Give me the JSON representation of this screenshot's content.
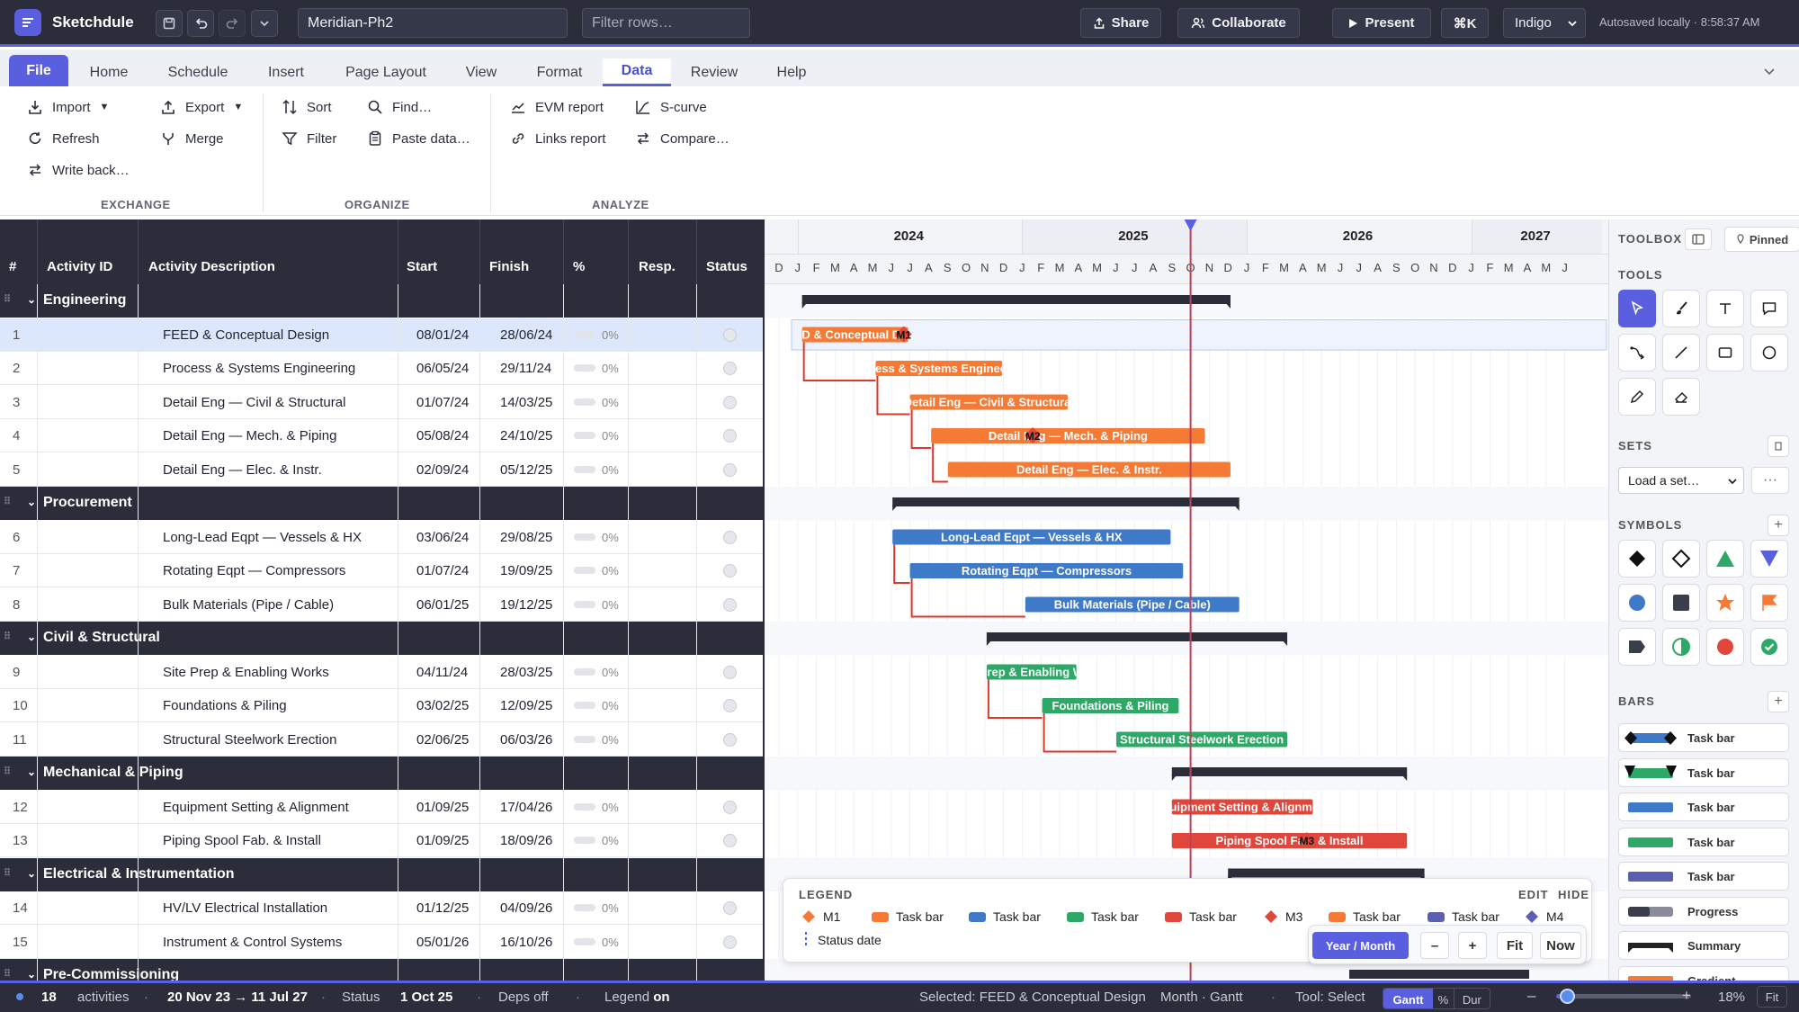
{
  "app": {
    "name": "Sketchdule",
    "doc_name": "Meridian-Ph2",
    "filter_placeholder": "Filter rows…",
    "autosave": "Autosaved locally · 8:58:37 AM"
  },
  "topbar": {
    "share": "Share",
    "collaborate": "Collaborate",
    "present": "Present",
    "shortcut": "⌘K",
    "theme": "Indigo"
  },
  "tabs": [
    "File",
    "Home",
    "Schedule",
    "Insert",
    "Page Layout",
    "View",
    "Format",
    "Data",
    "Review",
    "Help"
  ],
  "active_tab": "Data",
  "ribbon": {
    "exchange": {
      "label": "EXCHANGE",
      "items": [
        "Import",
        "Export",
        "Refresh",
        "Merge",
        "Write back…"
      ]
    },
    "organize": {
      "label": "ORGANIZE",
      "items": [
        "Sort",
        "Find…",
        "Filter",
        "Paste data…"
      ]
    },
    "analyze": {
      "label": "ANALYZE",
      "items": [
        "EVM report",
        "S-curve",
        "Links report",
        "Compare…"
      ]
    }
  },
  "columns": [
    "#",
    "Activity ID",
    "Activity Description",
    "Start",
    "Finish",
    "%",
    "Resp.",
    "Status"
  ],
  "groups": [
    {
      "name": "Engineering",
      "color": "#f47a35",
      "rows": [
        {
          "n": "1",
          "desc": "FEED & Conceptual Design",
          "start": "08/01/24",
          "finish": "28/06/24",
          "pct": "0%",
          "milestone": "M1"
        },
        {
          "n": "2",
          "desc": "Process & Systems Engineering",
          "start": "06/05/24",
          "finish": "29/11/24",
          "pct": "0%"
        },
        {
          "n": "3",
          "desc": "Detail Eng — Civil & Structural",
          "start": "01/07/24",
          "finish": "14/03/25",
          "pct": "0%"
        },
        {
          "n": "4",
          "desc": "Detail Eng — Mech. & Piping",
          "start": "05/08/24",
          "finish": "24/10/25",
          "pct": "0%",
          "milestone": "M2"
        },
        {
          "n": "5",
          "desc": "Detail Eng — Elec. & Instr.",
          "start": "02/09/24",
          "finish": "05/12/25",
          "pct": "0%"
        }
      ]
    },
    {
      "name": "Procurement",
      "color": "#3f7ac8",
      "rows": [
        {
          "n": "6",
          "desc": "Long-Lead Eqpt — Vessels & HX",
          "start": "03/06/24",
          "finish": "29/08/25",
          "pct": "0%"
        },
        {
          "n": "7",
          "desc": "Rotating Eqpt — Compressors",
          "start": "01/07/24",
          "finish": "19/09/25",
          "pct": "0%"
        },
        {
          "n": "8",
          "desc": "Bulk Materials (Pipe / Cable)",
          "start": "06/01/25",
          "finish": "19/12/25",
          "pct": "0%"
        }
      ]
    },
    {
      "name": "Civil & Structural",
      "color": "#2ea866",
      "rows": [
        {
          "n": "9",
          "desc": "Site Prep & Enabling Works",
          "start": "04/11/24",
          "finish": "28/03/25",
          "pct": "0%"
        },
        {
          "n": "10",
          "desc": "Foundations & Piling",
          "start": "03/02/25",
          "finish": "12/09/25",
          "pct": "0%"
        },
        {
          "n": "11",
          "desc": "Structural Steelwork Erection",
          "start": "02/06/25",
          "finish": "06/03/26",
          "pct": "0%"
        }
      ]
    },
    {
      "name": "Mechanical & Piping",
      "color": "#e0463a",
      "rows": [
        {
          "n": "12",
          "desc": "Equipment Setting & Alignment",
          "start": "01/09/25",
          "finish": "17/04/26",
          "pct": "0%"
        },
        {
          "n": "13",
          "desc": "Piping Spool Fab. & Install",
          "start": "01/09/25",
          "finish": "18/09/26",
          "pct": "0%",
          "milestone": "M3"
        }
      ]
    },
    {
      "name": "Electrical & Instrumentation",
      "color": "#f47a35",
      "rows": [
        {
          "n": "14",
          "desc": "HV/LV Electrical Installation",
          "start": "01/12/25",
          "finish": "04/09/26",
          "pct": "0%"
        },
        {
          "n": "15",
          "desc": "Instrument & Control Systems",
          "start": "05/01/26",
          "finish": "16/10/26",
          "pct": "0%"
        }
      ]
    },
    {
      "name": "Pre-Commissioning",
      "color": "#f47a35",
      "rows": []
    }
  ],
  "gantt": {
    "years": [
      "2024",
      "2025",
      "2026",
      "2027"
    ],
    "months": [
      "D",
      "J",
      "F",
      "M",
      "A",
      "M",
      "J",
      "J",
      "A",
      "S",
      "O",
      "N",
      "D",
      "J",
      "F",
      "M",
      "A",
      "M",
      "J",
      "J",
      "A",
      "S",
      "O",
      "N",
      "D",
      "J",
      "F",
      "M",
      "A",
      "M",
      "J",
      "J",
      "A",
      "S",
      "O",
      "N",
      "D",
      "J",
      "F",
      "M",
      "A",
      "M",
      "J"
    ],
    "bar_labels": [
      "FEED & Conceptual Design",
      "Process & Systems Engineering",
      "Detail Eng — Civil & Structural",
      "Detail Eng — Mech. & Piping",
      "Detail Eng — Elec. & Instr.",
      "Long-Lead Eqpt — Vessels & HX",
      "Rotating Eqpt — Compressors",
      "Bulk Materials (Pipe / Cable)",
      "Site Prep & Enabling Works",
      "Foundations & Piling",
      "Structural Steelwork Erection",
      "Equipment Setting & Alignment",
      "Piping Spool Fab. & Install"
    ]
  },
  "legend": {
    "title": "LEGEND",
    "edit": "EDIT",
    "hide": "HIDE",
    "items": [
      {
        "label": "M1",
        "kind": "diamond",
        "color": "#f47a35"
      },
      {
        "label": "Task bar",
        "kind": "bar",
        "color": "#f47a35"
      },
      {
        "label": "Task bar",
        "kind": "bar",
        "color": "#3f7ac8"
      },
      {
        "label": "Task bar",
        "kind": "bar",
        "color": "#2ea866"
      },
      {
        "label": "Task bar",
        "kind": "bar",
        "color": "#e0463a"
      },
      {
        "label": "M3",
        "kind": "diamond",
        "color": "#e0463a"
      },
      {
        "label": "Task bar",
        "kind": "bar",
        "color": "#f47a35"
      },
      {
        "label": "Task bar",
        "kind": "bar",
        "color": "#5a5fb0"
      },
      {
        "label": "M4",
        "kind": "diamond",
        "color": "#5a5fb0"
      }
    ],
    "status_date": "Status date"
  },
  "zoom": {
    "mode": "Year / Month",
    "minus": "–",
    "plus": "+",
    "fit": "Fit",
    "now": "Now"
  },
  "toolbox": {
    "title": "TOOLBOX",
    "pinned": "Pinned",
    "tools_label": "TOOLS",
    "sets_label": "SETS",
    "sets_placeholder": "Load a set…",
    "symbols_label": "SYMBOLS",
    "bars_label": "BARS",
    "bar_styles": [
      "Task bar",
      "Task bar",
      "Task bar",
      "Task bar",
      "Task bar",
      "Progress",
      "Summary",
      "Gradient"
    ]
  },
  "status": {
    "count": "18",
    "count_label": "activities",
    "range": "20 Nov 23 → 11 Jul 27",
    "status_label": "Status",
    "status_date": "1 Oct 25",
    "deps": "Deps off",
    "legend_label": "Legend",
    "legend_state": "on",
    "selected": "Selected: FEED & Conceptual Design",
    "view": "Month · Gantt",
    "tool": "Tool: Select",
    "seg_gantt": "Gantt",
    "seg_pct": "%",
    "seg_dur": "Dur",
    "zoom": "18%",
    "fit": "Fit"
  }
}
